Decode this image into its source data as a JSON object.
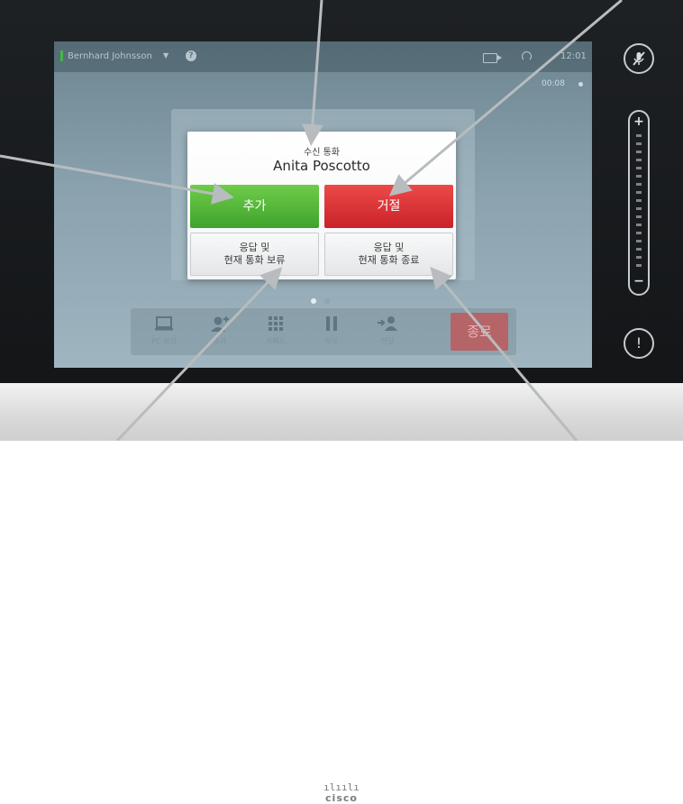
{
  "status_bar": {
    "user_name": "Bernhard Johnsson",
    "caret": "▼",
    "help": "?",
    "clock": "12:01",
    "call_timer": "00:08"
  },
  "incoming_call": {
    "subtitle": "수신 통화",
    "caller": "Anita Poscotto",
    "add_label": "추가",
    "decline_label": "거절",
    "answer_hold_line1": "응답 및",
    "answer_hold_line2": "현재 통화 보류",
    "answer_end_line1": "응답 및",
    "answer_end_line2": "현재 통화 종료"
  },
  "toolbar": {
    "items": [
      {
        "label": "PC 보기",
        "icon": "laptop-icon"
      },
      {
        "label": "추가",
        "icon": "add-participant-icon"
      },
      {
        "label": "키패드",
        "icon": "keypad-icon"
      },
      {
        "label": "보류",
        "icon": "pause-icon"
      },
      {
        "label": "전달",
        "icon": "transfer-icon"
      }
    ],
    "end_label": "종료"
  },
  "device": {
    "brand": "cisco",
    "brand_bars": "ılıılı"
  },
  "side_controls": {
    "volume_plus": "+",
    "volume_minus": "−",
    "alert": "!"
  },
  "colors": {
    "accept_green": "#4cb033",
    "decline_red": "#d9302f",
    "end_button": "#b56468",
    "user_indicator": "#45b649"
  }
}
